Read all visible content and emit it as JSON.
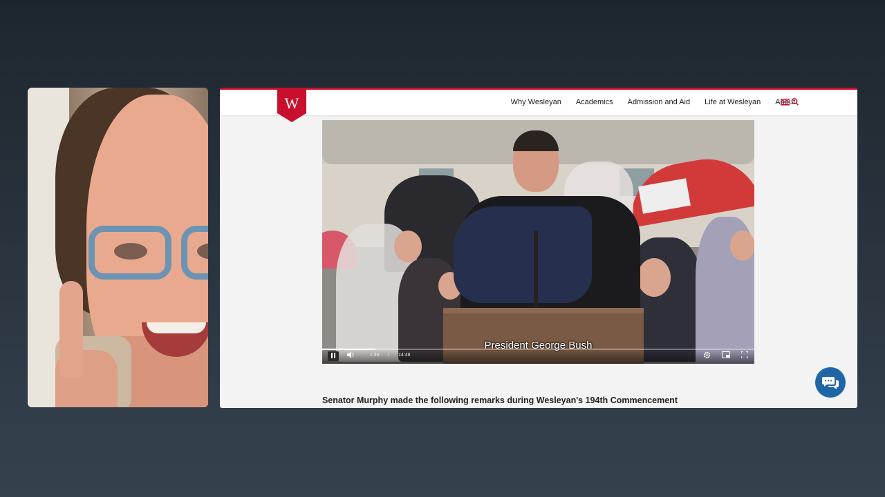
{
  "site": {
    "logo_letter": "W",
    "nav": [
      {
        "label": "Why Wesleyan"
      },
      {
        "label": "Academics"
      },
      {
        "label": "Admission and Aid"
      },
      {
        "label": "Life at Wesleyan"
      },
      {
        "label": "About"
      }
    ]
  },
  "video": {
    "caption": "President George Bush",
    "current_time": "1:49",
    "separator": "/",
    "duration": "14:48",
    "progress_fraction": 0.123
  },
  "article": {
    "intro": "Senator Murphy made the following remarks during Wesleyan's 194th Commencement"
  },
  "colors": {
    "brand_red": "#c8102e",
    "chat_blue": "#1f66a8"
  },
  "icons": {
    "menu": "hamburger-icon",
    "search": "search-icon",
    "play_pause": "pause-icon",
    "volume": "volume-icon",
    "settings": "gear-icon",
    "pip": "picture-in-picture-icon",
    "fullscreen": "fullscreen-icon",
    "chat": "chat-icon"
  }
}
